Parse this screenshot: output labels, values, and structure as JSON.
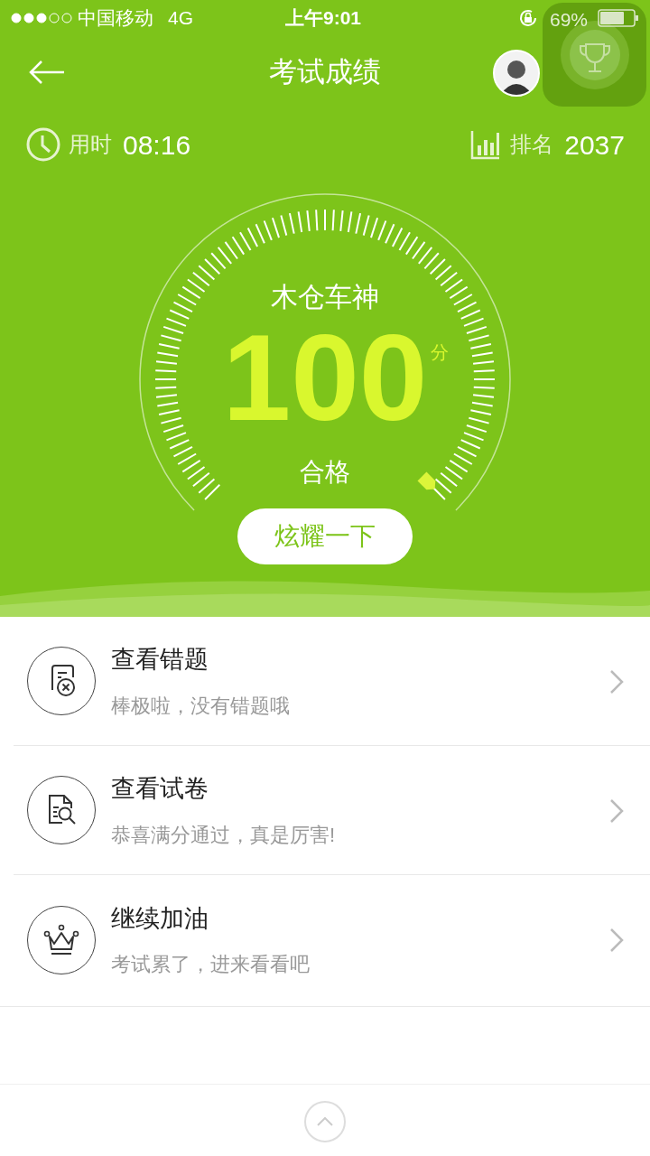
{
  "status_bar": {
    "carrier": "中国移动",
    "network": "4G",
    "time": "上午9:01",
    "battery": "69%"
  },
  "nav": {
    "title": "考试成绩"
  },
  "stats": {
    "time_label": "用时",
    "time_value": "08:16",
    "rank_label": "排名",
    "rank_value": "2037"
  },
  "gauge": {
    "title": "木仓车神",
    "score": "100",
    "unit": "分",
    "result": "合格"
  },
  "share_button": "炫耀一下",
  "items": [
    {
      "kind": "mistakes",
      "title": "查看错题",
      "subtitle": "棒极啦，没有错题哦"
    },
    {
      "kind": "paper",
      "title": "查看试卷",
      "subtitle": "恭喜满分通过，真是厉害!"
    },
    {
      "kind": "crown",
      "title": "继续加油",
      "subtitle": "考试累了，进来看看吧"
    }
  ]
}
